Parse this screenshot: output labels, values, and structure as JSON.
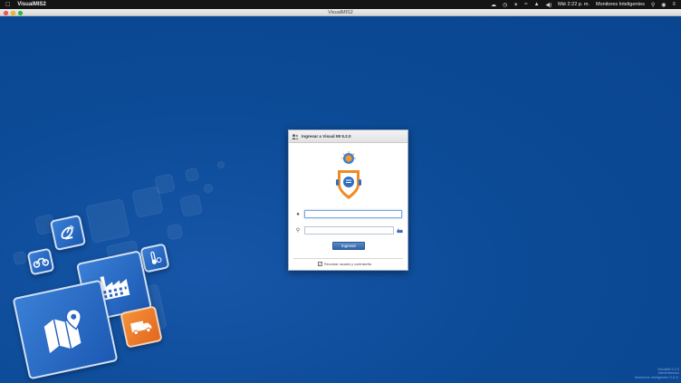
{
  "menubar": {
    "app_name": "VisualMIS2",
    "clock": "Mié 2:22 p. m.",
    "user": "Monitores Inteligentes"
  },
  "window": {
    "title": "VisualMIS2"
  },
  "login": {
    "title": "Ingresar a Visual MI 5.2.0",
    "username_value": "",
    "password_value": "",
    "submit_label": "Ingresar",
    "remember_label": "Recordar usuario y contraseña",
    "remember_checked": true
  },
  "footer": {
    "line1": "VisualMI 5.2.0",
    "line2": "Administrador",
    "line3": "Monitores Inteligentes S.A.S."
  },
  "colors": {
    "desktop_bg": "#0b4a96",
    "accent_orange": "#e4661c",
    "button_blue": "#2f64a8"
  }
}
